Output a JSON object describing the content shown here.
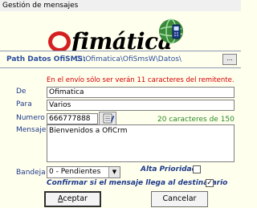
{
  "window": {
    "title": "Gestión de mensajes"
  },
  "logo": {
    "text": "fimática"
  },
  "path": {
    "label": "Path Datos OfiSMS:",
    "value": "C:\\Ofimatica\\OfiSmsW\\Datos\\",
    "browse_label": "..."
  },
  "form": {
    "warning": "En el envío sólo ser verán 11 caracteres del remitente.",
    "de_label": "De",
    "de_value": "Ofimatica",
    "para_label": "Para",
    "para_value": "Varios",
    "numero_label": "Numero",
    "numero_value": "666777888",
    "counter": "20 caracteres de 150",
    "mensaje_label": "Mensaje",
    "mensaje_value": "Bienvenidos a OfiCrm",
    "bandeja_label": "Bandeja",
    "bandeja_value": "0 - Pendientes",
    "alta_prioridad_label": "Alta Prioridad",
    "alta_prioridad_checked": false,
    "confirmar_label": "Confirmar si el mensaje llega al destinatario",
    "confirmar_checked": true
  },
  "buttons": {
    "ok_first": "A",
    "ok_rest": "ceptar",
    "cancel": "Cancelar"
  },
  "colors": {
    "background": "#ffffee",
    "label_blue": "#1e3a8a",
    "path_blue": "#2a4d9c",
    "warning_red": "#d40000",
    "counter_green": "#2b8a2b",
    "logo_red": "#d42020"
  },
  "icons": {
    "globe": "globe-phone-icon",
    "contacts": "address-book-icon"
  }
}
